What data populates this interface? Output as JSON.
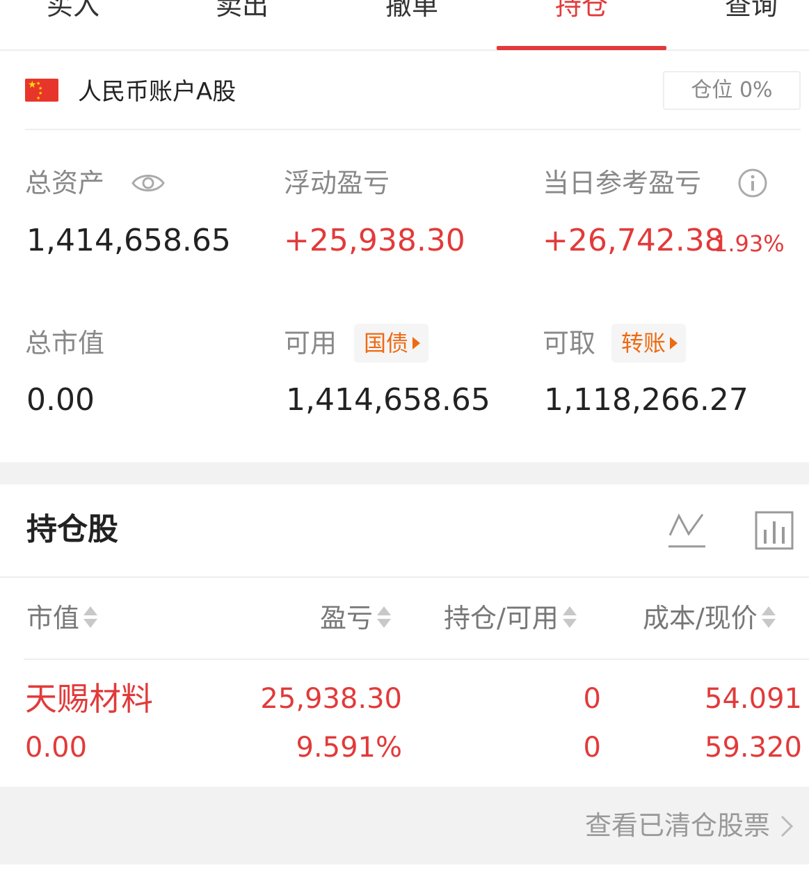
{
  "tabs": [
    {
      "label": "买入"
    },
    {
      "label": "卖出"
    },
    {
      "label": "撤单"
    },
    {
      "label": "持仓",
      "active": true
    },
    {
      "label": "查询"
    }
  ],
  "account": {
    "flag": "china-flag-icon",
    "name": "人民币账户A股",
    "position_label": "仓位 0%"
  },
  "summary": {
    "total_assets_label": "总资产",
    "total_assets": "1,414,658.65",
    "floating_pl_label": "浮动盈亏",
    "floating_pl": "+25,938.30",
    "daily_pl_label": "当日参考盈亏",
    "daily_pl": "+26,742.38",
    "daily_pl_pct": "1.93%",
    "market_value_label": "总市值",
    "market_value": "0.00",
    "available_label": "可用",
    "available_tag": "国债",
    "available": "1,414,658.65",
    "withdrawable_label": "可取",
    "withdrawable_tag": "转账",
    "withdrawable": "1,118,266.27"
  },
  "holdings": {
    "title": "持仓股",
    "columns": [
      "市值",
      "盈亏",
      "持仓/可用",
      "成本/现价"
    ],
    "rows": [
      {
        "name": "天赐材料",
        "market_value": "0.00",
        "pl": "25,938.30",
        "pl_pct": "9.591%",
        "position": "0",
        "available": "0",
        "cost": "54.091",
        "price": "59.320"
      }
    ]
  },
  "footer": {
    "cleared_link": "查看已清仓股票"
  },
  "colors": {
    "accent_red": "#e23a3a",
    "tag_orange": "#ee6a12",
    "muted_gray": "#888888"
  }
}
